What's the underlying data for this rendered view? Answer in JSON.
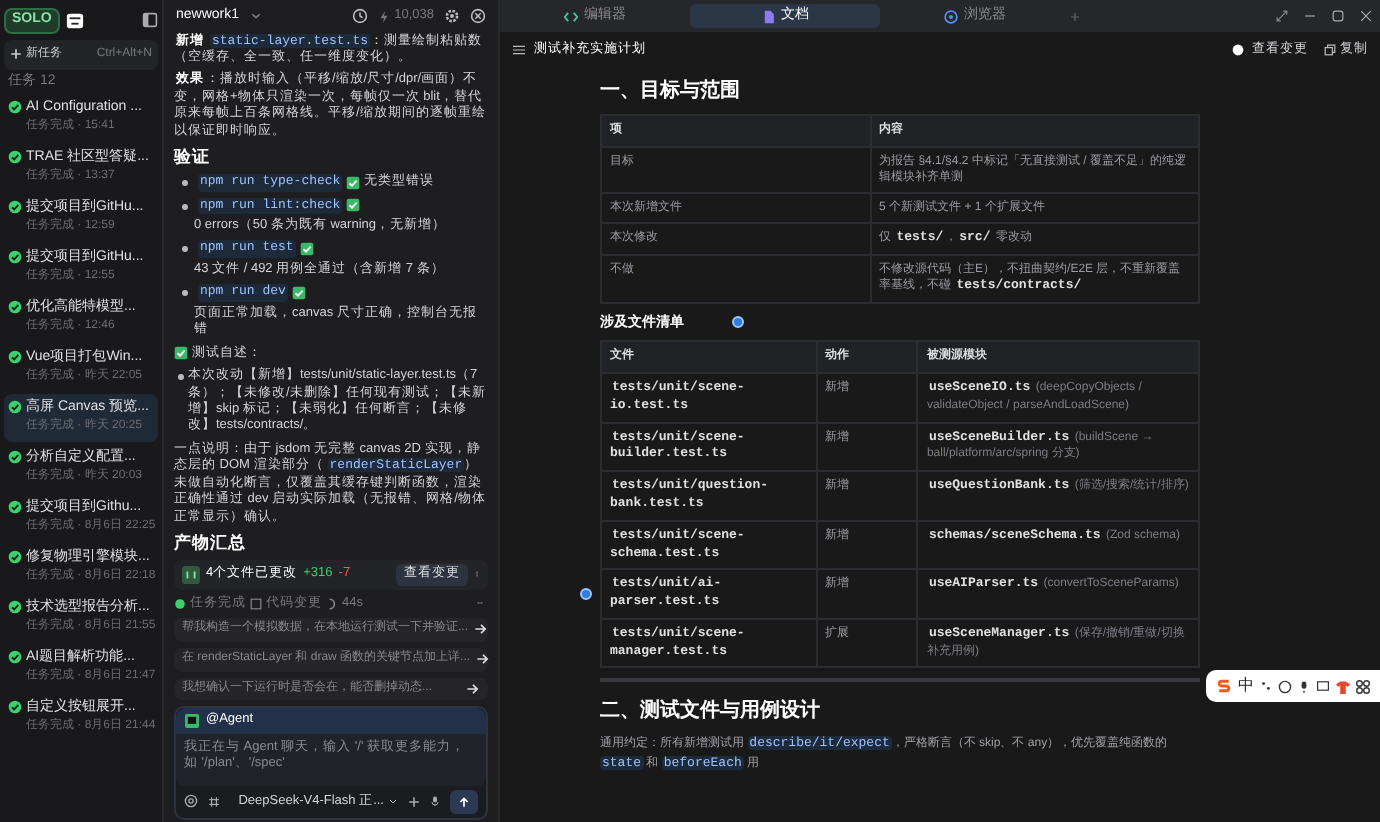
{
  "sidebar": {
    "logo": "SOLO",
    "new_task": {
      "label": "新任务",
      "shortcut": "Ctrl+Alt+N"
    },
    "task_count": "任务 12",
    "tasks": [
      {
        "title": "AI Configuration ...",
        "meta": "任务完成 · 15:41",
        "selected": false
      },
      {
        "title": "TRAE 社区型答疑...",
        "meta": "任务完成 · 13:37",
        "selected": false
      },
      {
        "title": "提交项目到GitHu...",
        "meta": "任务完成 · 12:59",
        "selected": false
      },
      {
        "title": "提交项目到GitHu...",
        "meta": "任务完成 · 12:55",
        "selected": false
      },
      {
        "title": "优化高能特模型...",
        "meta": "任务完成 · 12:46",
        "selected": false
      },
      {
        "title": "Vue项目打包Win...",
        "meta": "任务完成 · 昨天 22:05",
        "selected": false
      },
      {
        "title": "高屏 Canvas 预览...",
        "meta": "任务完成 · 昨天 20:25",
        "selected": true
      },
      {
        "title": "分析自定义配置...",
        "meta": "任务完成 · 昨天 20:03",
        "selected": false
      },
      {
        "title": "提交项目到Githu...",
        "meta": "任务完成 · 8月6日 22:25",
        "selected": false
      },
      {
        "title": "修复物理引擎模块...",
        "meta": "任务完成 · 8月6日 22:18",
        "selected": false
      },
      {
        "title": "技术选型报告分析...",
        "meta": "任务完成 · 8月6日 21:55",
        "selected": false
      },
      {
        "title": "AI题目解析功能...",
        "meta": "任务完成 · 8月6日 21:47",
        "selected": false
      },
      {
        "title": "自定义按钮展开...",
        "meta": "任务完成 · 8月6日 21:44",
        "selected": false
      }
    ]
  },
  "chat": {
    "workspace": "newwork1",
    "credits": "10,038",
    "blocks": [
      {
        "kind": "para",
        "parts": [
          {
            "kind": "bold",
            "text": "新增"
          },
          {
            "kind": "code",
            "text": "static-layer.test.ts"
          },
          {
            "kind": "text",
            "text": "：测量绘制粘贴数（空缓存、全一致、任一维度变化）。"
          }
        ]
      },
      {
        "kind": "para",
        "parts": [
          {
            "kind": "bold",
            "text": "效果"
          },
          {
            "kind": "text",
            "text": "：播放时输入（平移/缩放/尺寸/dpr/画面）不变，网格+物体只渲染一次，每帧仅一次 blit，替代原来每帧上百条网格线。平移/缩放期间的逐帧重绘以保证即时响应。"
          }
        ]
      },
      {
        "kind": "heading",
        "text": "验证"
      },
      {
        "kind": "checks",
        "items": [
          {
            "command": "npm run type-check",
            "result": "无类型错误"
          },
          {
            "command": "npm run lint:check",
            "result": "0 errors（50 条为既有 warning，无新增）"
          },
          {
            "command": "npm run test",
            "result": "43 文件 / 492 用例全通过（含新增 7 条）"
          },
          {
            "command": "npm run dev",
            "result": "页面正常加载，canvas 尺寸正确，控制台无报错"
          }
        ]
      },
      {
        "kind": "checked_note",
        "text": "测试自述："
      },
      {
        "kind": "bullets",
        "items": [
          "本次改动【新增】tests/unit/static-layer.test.ts（7 条）；【未修改/未删除】任何现有测试；【未新增】skip 标记；【未弱化】任何断言；【未修改】tests/contracts/。"
        ]
      },
      {
        "kind": "para",
        "parts": [
          {
            "kind": "text",
            "text": "一点说明：由于 jsdom 无完整 canvas 2D 实现，静态层的 DOM 渲染部分（"
          },
          {
            "kind": "code",
            "text": "renderStaticLayer"
          },
          {
            "kind": "text",
            "text": "）未做自动化断言，仅覆盖其缓存键判断函数，渲染正确性通过 dev 启动实际加载（无报错、网格/物体正常显示）确认。"
          }
        ]
      },
      {
        "kind": "heading",
        "text": "产物汇总"
      }
    ],
    "changes": {
      "label": "4个文件已更改",
      "added": "+316",
      "removed": "-7",
      "button": "查看变更"
    },
    "status": {
      "state": "任务完成",
      "changes": "代码变更",
      "duration": "44s"
    },
    "suggestions": [
      "帮我构造一个模拟数据，在本地运行测试一下并验证...",
      "在 renderStaticLayer 和 draw 函数的关键节点加上详...",
      "我想确认一下运行时是否会在，能否删掉动态..."
    ],
    "input": {
      "agent": "@Agent",
      "placeholder": "我正在与 Agent 聊天，输入 '/' 获取更多能力，如 '/plan'、'/spec'",
      "model": "DeepSeek-V4-Flash 正..."
    }
  },
  "editor_tabs": [
    {
      "label": "编辑器",
      "selected": false
    },
    {
      "label": "文档",
      "selected": true
    },
    {
      "label": "浏览器",
      "selected": false
    }
  ],
  "document": {
    "title": "测试补充实施计划",
    "view_changes": "查看变更",
    "copy": "复制",
    "sections": [
      {
        "kind": "h2",
        "text": "一、目标与范围"
      },
      {
        "kind": "table",
        "columns": [
          "项",
          "内容"
        ],
        "rows": [
          [
            "目标",
            "为报告 §4.1/§4.2 中标记「无直接测试 / 覆盖不足」的纯逻辑模块补齐单测"
          ],
          [
            "本次新增文件",
            "5 个新测试文件 + 1 个扩展文件"
          ],
          [
            "本次修改",
            [
              {
                "kind": "text",
                "text": "仅 "
              },
              {
                "kind": "code",
                "text": "tests/"
              },
              {
                "kind": "text",
                "text": "，"
              },
              {
                "kind": "code",
                "text": "src/"
              },
              {
                "kind": "text",
                "text": " 零改动"
              }
            ]
          ],
          [
            "不做",
            [
              {
                "kind": "text",
                "text": "不修改源代码（主E），不扭曲契约/E2E 层，不重新覆盖率基线，不碰 "
              },
              {
                "kind": "code",
                "text": "tests/contracts/"
              }
            ]
          ]
        ]
      },
      {
        "kind": "h3",
        "text": "涉及文件清单"
      },
      {
        "kind": "table",
        "columns": [
          "文件",
          "动作",
          "被测源模块"
        ],
        "rows": [
          [
            [
              {
                "kind": "code",
                "text": "tests/unit/scene-io.test.ts"
              }
            ],
            "新增",
            [
              {
                "kind": "code",
                "text": "useSceneIO.ts"
              },
              {
                "kind": "muted",
                "text": " (deepCopyObjects / validateObject / parseAndLoadScene)"
              }
            ]
          ],
          [
            [
              {
                "kind": "code",
                "text": "tests/unit/scene-builder.test.ts"
              }
            ],
            "新增",
            [
              {
                "kind": "code",
                "text": "useSceneBuilder.ts"
              },
              {
                "kind": "muted",
                "text": " (buildScene → ball/platform/arc/spring 分支)"
              }
            ]
          ],
          [
            [
              {
                "kind": "code",
                "text": "tests/unit/question-bank.test.ts"
              }
            ],
            "新增",
            [
              {
                "kind": "code",
                "text": "useQuestionBank.ts"
              },
              {
                "kind": "muted",
                "text": " (筛选/搜索/统计/排序)"
              }
            ]
          ],
          [
            [
              {
                "kind": "code",
                "text": "tests/unit/scene-schema.test.ts"
              }
            ],
            "新增",
            [
              {
                "kind": "code",
                "text": "schemas/sceneSchema.ts"
              },
              {
                "kind": "muted",
                "text": " (Zod schema)"
              }
            ]
          ],
          [
            [
              {
                "kind": "code",
                "text": "tests/unit/ai-parser.test.ts"
              }
            ],
            "新增",
            [
              {
                "kind": "code",
                "text": "useAIParser.ts"
              },
              {
                "kind": "muted",
                "text": " (convertToSceneParams)"
              }
            ]
          ],
          [
            [
              {
                "kind": "code",
                "text": "tests/unit/scene-manager.test.ts"
              }
            ],
            "扩展",
            [
              {
                "kind": "code",
                "text": "useSceneManager.ts"
              },
              {
                "kind": "muted",
                "text": " (保存/撤销/重做/切换补充用例)"
              }
            ]
          ]
        ]
      },
      {
        "kind": "rule"
      },
      {
        "kind": "h2",
        "text": "二、测试文件与用例设计"
      },
      {
        "kind": "para",
        "parts": [
          {
            "kind": "text",
            "text": "通用约定：所有新增测试用 "
          },
          {
            "kind": "code",
            "text": "describe/it/expect"
          },
          {
            "kind": "text",
            "text": "，严格断言（不 skip、不 any），优先覆盖纯函数的 "
          },
          {
            "kind": "code",
            "text": "state"
          },
          {
            "kind": "text",
            "text": " 和 "
          },
          {
            "kind": "code",
            "text": "beforeEach"
          },
          {
            "kind": "text",
            "text": " 用"
          }
        ]
      }
    ]
  },
  "ime_toolbar": {
    "mode": "中"
  }
}
